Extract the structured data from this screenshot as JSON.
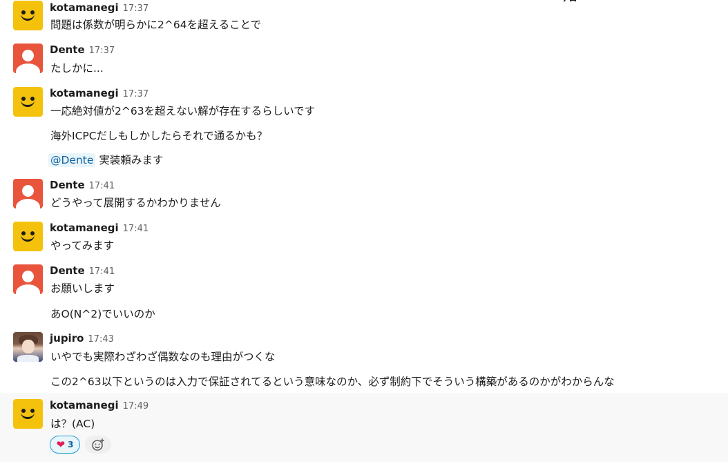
{
  "date_divider": "今日",
  "messages": [
    {
      "sender": "kotamanegi",
      "time": "17:37",
      "avatar": "smile-avatar",
      "lines": [
        "問題は係数が明らかに2^64を超えることで"
      ]
    },
    {
      "sender": "Dente",
      "time": "17:37",
      "avatar": "person-avatar",
      "lines": [
        "たしかに..."
      ]
    },
    {
      "sender": "kotamanegi",
      "time": "17:37",
      "avatar": "smile-avatar",
      "lines": [
        "一応絶対値が2^63を超えない解が存在するらしいです",
        "海外ICPCだしもしかしたらそれで通るかも？"
      ],
      "mention": "@Dente",
      "mention_text": "実装頼みます"
    },
    {
      "sender": "Dente",
      "time": "17:41",
      "avatar": "person-avatar",
      "lines": [
        "どうやって展開するかわかりません"
      ]
    },
    {
      "sender": "kotamanegi",
      "time": "17:41",
      "avatar": "smile-avatar",
      "lines": [
        "やってみます"
      ]
    },
    {
      "sender": "Dente",
      "time": "17:41",
      "avatar": "person-avatar",
      "lines": [
        "お願いします",
        "あO(N^2)でいいのか"
      ]
    },
    {
      "sender": "jupiro",
      "time": "17:43",
      "avatar": "anime-avatar",
      "lines": [
        "いやでも実際わざわざ偶数なのも理由がつくな",
        "この2^63以下というのは入力で保証されてるという意味なのか、必ず制約下でそういう構築があるのかがわからんな"
      ]
    },
    {
      "sender": "kotamanegi",
      "time": "17:49",
      "avatar": "smile-avatar",
      "lines": [
        "は？(AC)"
      ]
    }
  ],
  "reaction": {
    "emoji": "❤",
    "count": "3"
  },
  "icons": {
    "add_reaction": "add-reaction-icon",
    "heart": "heart-icon"
  },
  "colors": {
    "mention_bg": "#e8f5fa",
    "mention_text": "#1264a3",
    "reaction_border": "#1d9bd1",
    "smile_avatar": "#f4c20d",
    "person_avatar": "#e8553c"
  }
}
